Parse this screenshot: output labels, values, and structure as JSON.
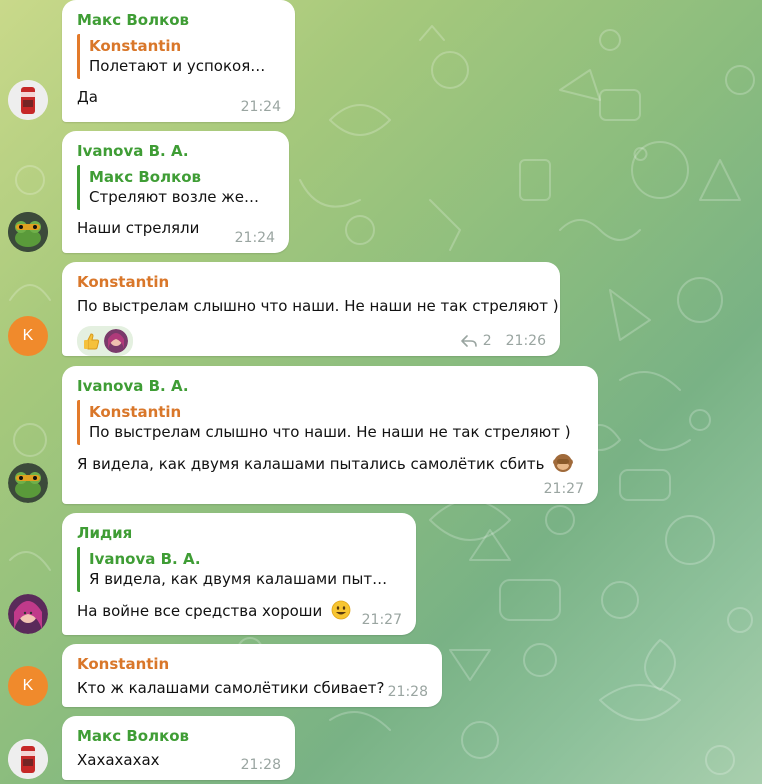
{
  "colors": {
    "name_green": "#3f9d35",
    "name_orange": "#d9772a",
    "name_purple": "#8a55c4",
    "time_gray": "#9aa5a1",
    "bubble": "#ffffff"
  },
  "messages": [
    {
      "sender": "Макс Волков",
      "reply_name": "Konstantin",
      "reply_text": "Полетают и успокоятс...",
      "text": "Да",
      "time": "21:24",
      "avatar_icon": "soda-can-avatar-icon"
    },
    {
      "sender": "Ivanova B. A.",
      "reply_name": "Макс Волков",
      "reply_text": "Стреляют возле желе...",
      "text": "Наши стреляли",
      "time": "21:24",
      "avatar_icon": "frog-avatar-icon"
    },
    {
      "sender": "Konstantin",
      "text": "По выстрелам слышно что наши. Не наши не так стреляют )",
      "reaction_icon": "thumbs-up-icon",
      "reply_count": "2",
      "time": "21:26",
      "avatar_letter": "K"
    },
    {
      "sender": "Ivanova B. A.",
      "reply_name": "Konstantin",
      "reply_text": "По выстрелам слышно что наши. Не наши не так стреляют )",
      "text": "Я видела, как двумя калашами пытались самолётик сбить",
      "emoji": "see-no-evil-monkey-icon",
      "time": "21:27",
      "avatar_icon": "frog-avatar-icon"
    },
    {
      "sender": "Лидия",
      "reply_name": "Ivanova B. A.",
      "reply_text": "Я видела, как двумя калашами пытали...",
      "text": "На войне все средства хороши",
      "emoji": "grinning-face-icon",
      "time": "21:27",
      "avatar_icon": "girl-photo-avatar-icon"
    },
    {
      "sender": "Konstantin",
      "text": "Кто ж калашами самолётики сбивает?",
      "time": "21:28",
      "avatar_letter": "K"
    },
    {
      "sender": "Макс Волков",
      "text": "Хахахахах",
      "time": "21:28",
      "avatar_icon": "soda-can-avatar-icon"
    }
  ]
}
